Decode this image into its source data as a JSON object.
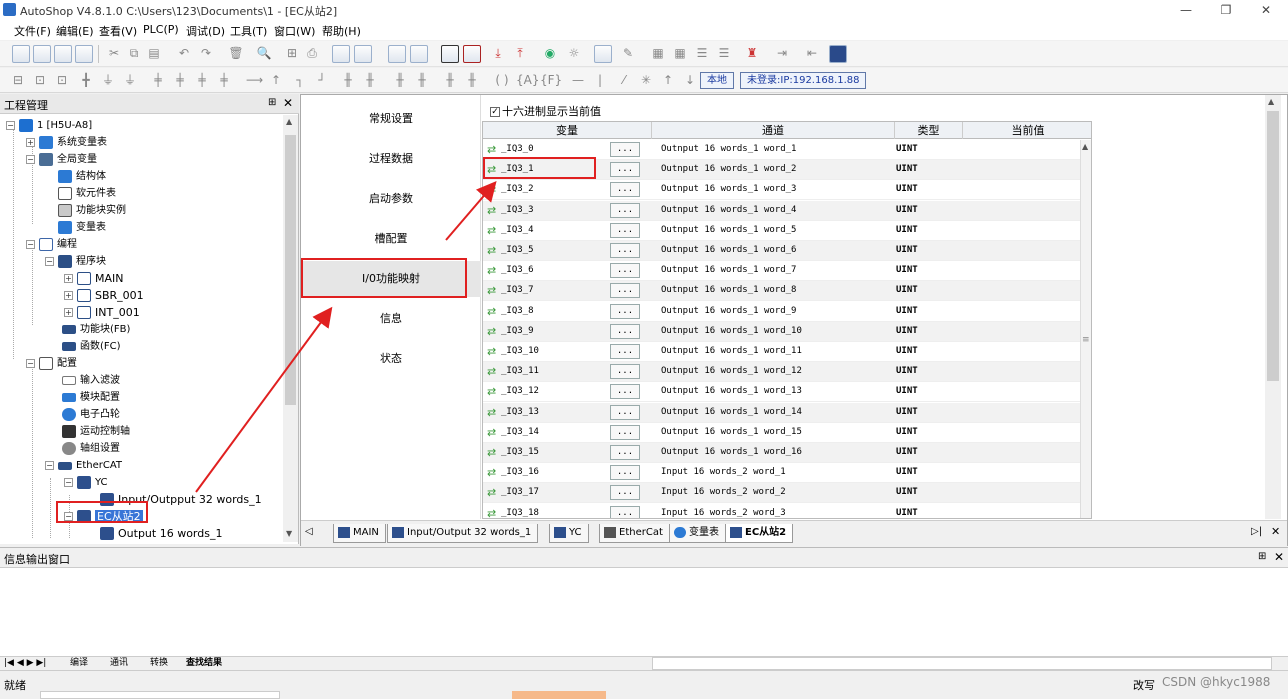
{
  "window": {
    "title": "AutoShop V4.8.1.0  C:\\Users\\123\\Documents\\1 - [EC从站2]"
  },
  "menu": [
    "文件(F)",
    "编辑(E)",
    "查看(V)",
    "PLC(P)",
    "调试(D)",
    "工具(T)",
    "窗口(W)",
    "帮助(H)"
  ],
  "toolbar2": {
    "local_label": "本地",
    "login_label": "未登录:IP:192.168.1.88"
  },
  "project_panel": {
    "title": "工程管理",
    "tree": [
      {
        "label": "1 [H5U-A8]"
      },
      {
        "label": "系统变量表"
      },
      {
        "label": "全局变量"
      },
      {
        "label": "结构体"
      },
      {
        "label": "软元件表"
      },
      {
        "label": "功能块实例"
      },
      {
        "label": "变量表"
      },
      {
        "label": "编程"
      },
      {
        "label": "程序块"
      },
      {
        "label": "MAIN"
      },
      {
        "label": "SBR_001"
      },
      {
        "label": "INT_001"
      },
      {
        "label": "功能块(FB)"
      },
      {
        "label": "函数(FC)"
      },
      {
        "label": "配置"
      },
      {
        "label": "输入滤波"
      },
      {
        "label": "模块配置"
      },
      {
        "label": "电子凸轮"
      },
      {
        "label": "运动控制轴"
      },
      {
        "label": "轴组设置"
      },
      {
        "label": "EtherCAT"
      },
      {
        "label": "YC"
      },
      {
        "label": "Input/Outpput 32 words_1"
      },
      {
        "label": "EC从站2"
      },
      {
        "label": "Output 16 words_1"
      }
    ]
  },
  "config_nav": [
    "常规设置",
    "过程数据",
    "启动参数",
    "槽配置",
    "I/0功能映射",
    "信息",
    "状态"
  ],
  "io_map": {
    "hex_checkbox_label": "十六进制显示当前值",
    "hex_checked": true,
    "columns": [
      "变量",
      "通道",
      "类型",
      "当前值"
    ],
    "rows": [
      {
        "variable": "_IQ3_0",
        "button": "...",
        "channel": "Outnput 16 words_1 word_1",
        "type": "UINT"
      },
      {
        "variable": "_IQ3_1",
        "button": "...",
        "channel": "Outnput 16 words_1 word_2",
        "type": "UINT"
      },
      {
        "variable": "_IQ3_2",
        "button": "...",
        "channel": "Outnput 16 words_1 word_3",
        "type": "UINT"
      },
      {
        "variable": "_IQ3_3",
        "button": "...",
        "channel": "Outnput 16 words_1 word_4",
        "type": "UINT"
      },
      {
        "variable": "_IQ3_4",
        "button": "...",
        "channel": "Outnput 16 words_1 word_5",
        "type": "UINT"
      },
      {
        "variable": "_IQ3_5",
        "button": "...",
        "channel": "Outnput 16 words_1 word_6",
        "type": "UINT"
      },
      {
        "variable": "_IQ3_6",
        "button": "...",
        "channel": "Outnput 16 words_1 word_7",
        "type": "UINT"
      },
      {
        "variable": "_IQ3_7",
        "button": "...",
        "channel": "Outnput 16 words_1 word_8",
        "type": "UINT"
      },
      {
        "variable": "_IQ3_8",
        "button": "...",
        "channel": "Outnput 16 words_1 word_9",
        "type": "UINT"
      },
      {
        "variable": "_IQ3_9",
        "button": "...",
        "channel": "Outnput 16 words_1 word_10",
        "type": "UINT"
      },
      {
        "variable": "_IQ3_10",
        "button": "...",
        "channel": "Outnput 16 words_1 word_11",
        "type": "UINT"
      },
      {
        "variable": "_IQ3_11",
        "button": "...",
        "channel": "Outnput 16 words_1 word_12",
        "type": "UINT"
      },
      {
        "variable": "_IQ3_12",
        "button": "...",
        "channel": "Outnput 16 words_1 word_13",
        "type": "UINT"
      },
      {
        "variable": "_IQ3_13",
        "button": "...",
        "channel": "Outnput 16 words_1 word_14",
        "type": "UINT"
      },
      {
        "variable": "_IQ3_14",
        "button": "...",
        "channel": "Outnput 16 words_1 word_15",
        "type": "UINT"
      },
      {
        "variable": "_IQ3_15",
        "button": "...",
        "channel": "Outnput 16 words_1 word_16",
        "type": "UINT"
      },
      {
        "variable": "_IQ3_16",
        "button": "...",
        "channel": "Input 16 words_2 word_1",
        "type": "UINT"
      },
      {
        "variable": "_IQ3_17",
        "button": "...",
        "channel": "Input 16 words_2 word_2",
        "type": "UINT"
      },
      {
        "variable": "_IQ3_18",
        "button": "...",
        "channel": "Input 16 words_2 word_3",
        "type": "UINT"
      }
    ]
  },
  "doc_tabs": [
    "MAIN",
    "Input/Output 32 words_1",
    "YC",
    "EtherCat",
    "变量表",
    "EC从站2"
  ],
  "info_panel": {
    "title": "信息输出窗口",
    "tabs": [
      "编译",
      "通讯",
      "转换",
      "查找结果"
    ]
  },
  "status": {
    "ready": "就绪",
    "rewrite": "改写",
    "watermark": "CSDN @hkyc1988"
  },
  "colors": {
    "highlight": "#e02020",
    "selected_tree": "#3875d7"
  }
}
